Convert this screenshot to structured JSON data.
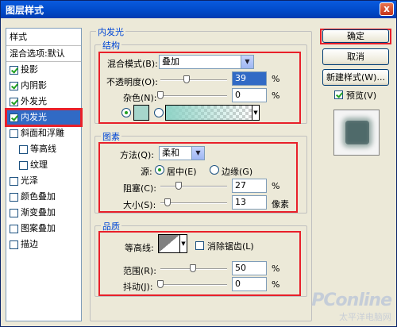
{
  "window": {
    "title": "图层样式",
    "close_glyph": "x"
  },
  "style_list": {
    "header": "样式",
    "blend_options": "混合选项:默认",
    "items": [
      {
        "label": "投影",
        "checked": true
      },
      {
        "label": "内阴影",
        "checked": true
      },
      {
        "label": "外发光",
        "checked": true
      },
      {
        "label": "内发光",
        "checked": true,
        "selected": true
      },
      {
        "label": "斜面和浮雕",
        "checked": false
      },
      {
        "label": "等高线",
        "checked": false,
        "sub": true
      },
      {
        "label": "纹理",
        "checked": false,
        "sub": true
      },
      {
        "label": "光泽",
        "checked": false
      },
      {
        "label": "颜色叠加",
        "checked": false
      },
      {
        "label": "渐变叠加",
        "checked": false
      },
      {
        "label": "图案叠加",
        "checked": false
      },
      {
        "label": "描边",
        "checked": false
      }
    ]
  },
  "panel": {
    "title": "内发光",
    "structure": {
      "title": "结构",
      "blend_mode_label": "混合模式(B):",
      "blend_mode_value": "叠加",
      "opacity_label": "不透明度(O):",
      "opacity_value": "39",
      "noise_label": "杂色(N):",
      "noise_value": "0",
      "percent": "%"
    },
    "elements": {
      "title": "图素",
      "method_label": "方法(Q):",
      "method_value": "柔和",
      "source_label": "源:",
      "center_label": "居中(E)",
      "edge_label": "边缘(G)",
      "choke_label": "阻塞(C):",
      "choke_value": "27",
      "size_label": "大小(S):",
      "size_value": "13",
      "percent": "%",
      "pixels": "像素"
    },
    "quality": {
      "title": "品质",
      "contour_label": "等高线:",
      "antialias_label": "消除锯齿(L)",
      "range_label": "范围(R):",
      "range_value": "50",
      "jitter_label": "抖动(J):",
      "jitter_value": "0",
      "percent": "%"
    }
  },
  "buttons": {
    "ok": "确定",
    "cancel": "取消",
    "new_style": "新建样式(W)...",
    "preview_label": "预览(V)"
  },
  "watermark": {
    "logo": "PConline",
    "sub": "太平洋电脑网"
  },
  "colors": {
    "glow": "#a6d6cb",
    "accent_red": "#e8202a",
    "selection": "#316ac5"
  }
}
